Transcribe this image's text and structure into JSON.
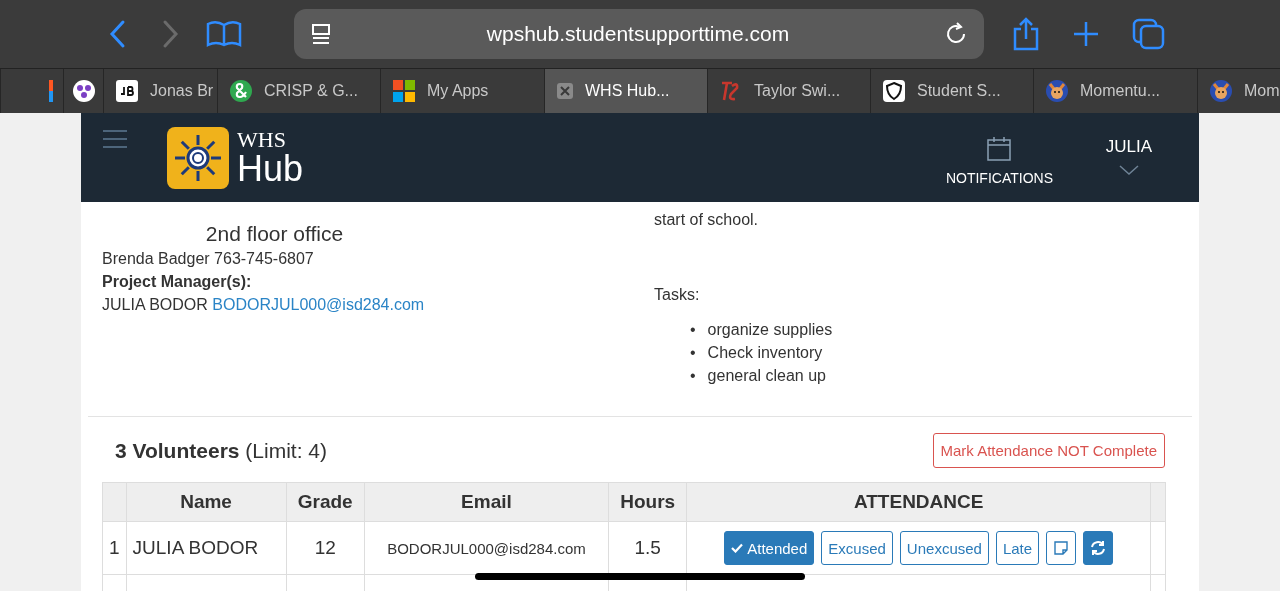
{
  "browser": {
    "url": "wpshub.studentsupporttime.com"
  },
  "tabs": [
    {
      "selected": false
    },
    {
      "selected": false
    },
    {
      "title": "Jonas Br",
      "selected": false
    },
    {
      "title": "CRISP & G...",
      "selected": false
    },
    {
      "title": "My Apps",
      "selected": false
    },
    {
      "title": "WHS Hub...",
      "selected": true
    },
    {
      "title": "Taylor Swi...",
      "selected": false
    },
    {
      "title": "Student S...",
      "selected": false
    },
    {
      "title": "Momentu...",
      "selected": false
    },
    {
      "title": "Mom",
      "selected": false
    }
  ],
  "navbar": {
    "logo_top": "WHS",
    "logo_bottom": "Hub",
    "notifications": "NOTIFICATIONS",
    "user": "JULIA"
  },
  "details": {
    "location": "2nd floor office",
    "contact": "Brenda Badger 763-745-6807",
    "pm_label": "Project Manager(s):",
    "pm_name": "JULIA BODOR",
    "pm_email": "BODORJUL000@isd284.com",
    "description_tail": "start of school.",
    "tasks_label": "Tasks:",
    "tasks": [
      {
        "marker": "•",
        "text": "organize supplies"
      },
      {
        "marker": "•",
        "text": "Check inventory"
      },
      {
        "marker": "•",
        "text": "general clean up"
      }
    ]
  },
  "volunteers": {
    "count": "3 Volunteers",
    "limit": "(Limit: 4)",
    "mark_button": "Mark Attendance NOT Complete",
    "columns": [
      "Name",
      "Grade",
      "Email",
      "Hours",
      "ATTENDANCE"
    ],
    "rows": [
      {
        "index": "1",
        "name": "JULIA BODOR",
        "grade": "12",
        "email": "BODORJUL000@isd284.com",
        "hours": "1.5",
        "attendance": [
          {
            "label": "Attended",
            "selected": true
          },
          {
            "label": "Excused",
            "selected": false
          },
          {
            "label": "Unexcused",
            "selected": false
          },
          {
            "label": "Late",
            "selected": false
          }
        ]
      }
    ]
  }
}
